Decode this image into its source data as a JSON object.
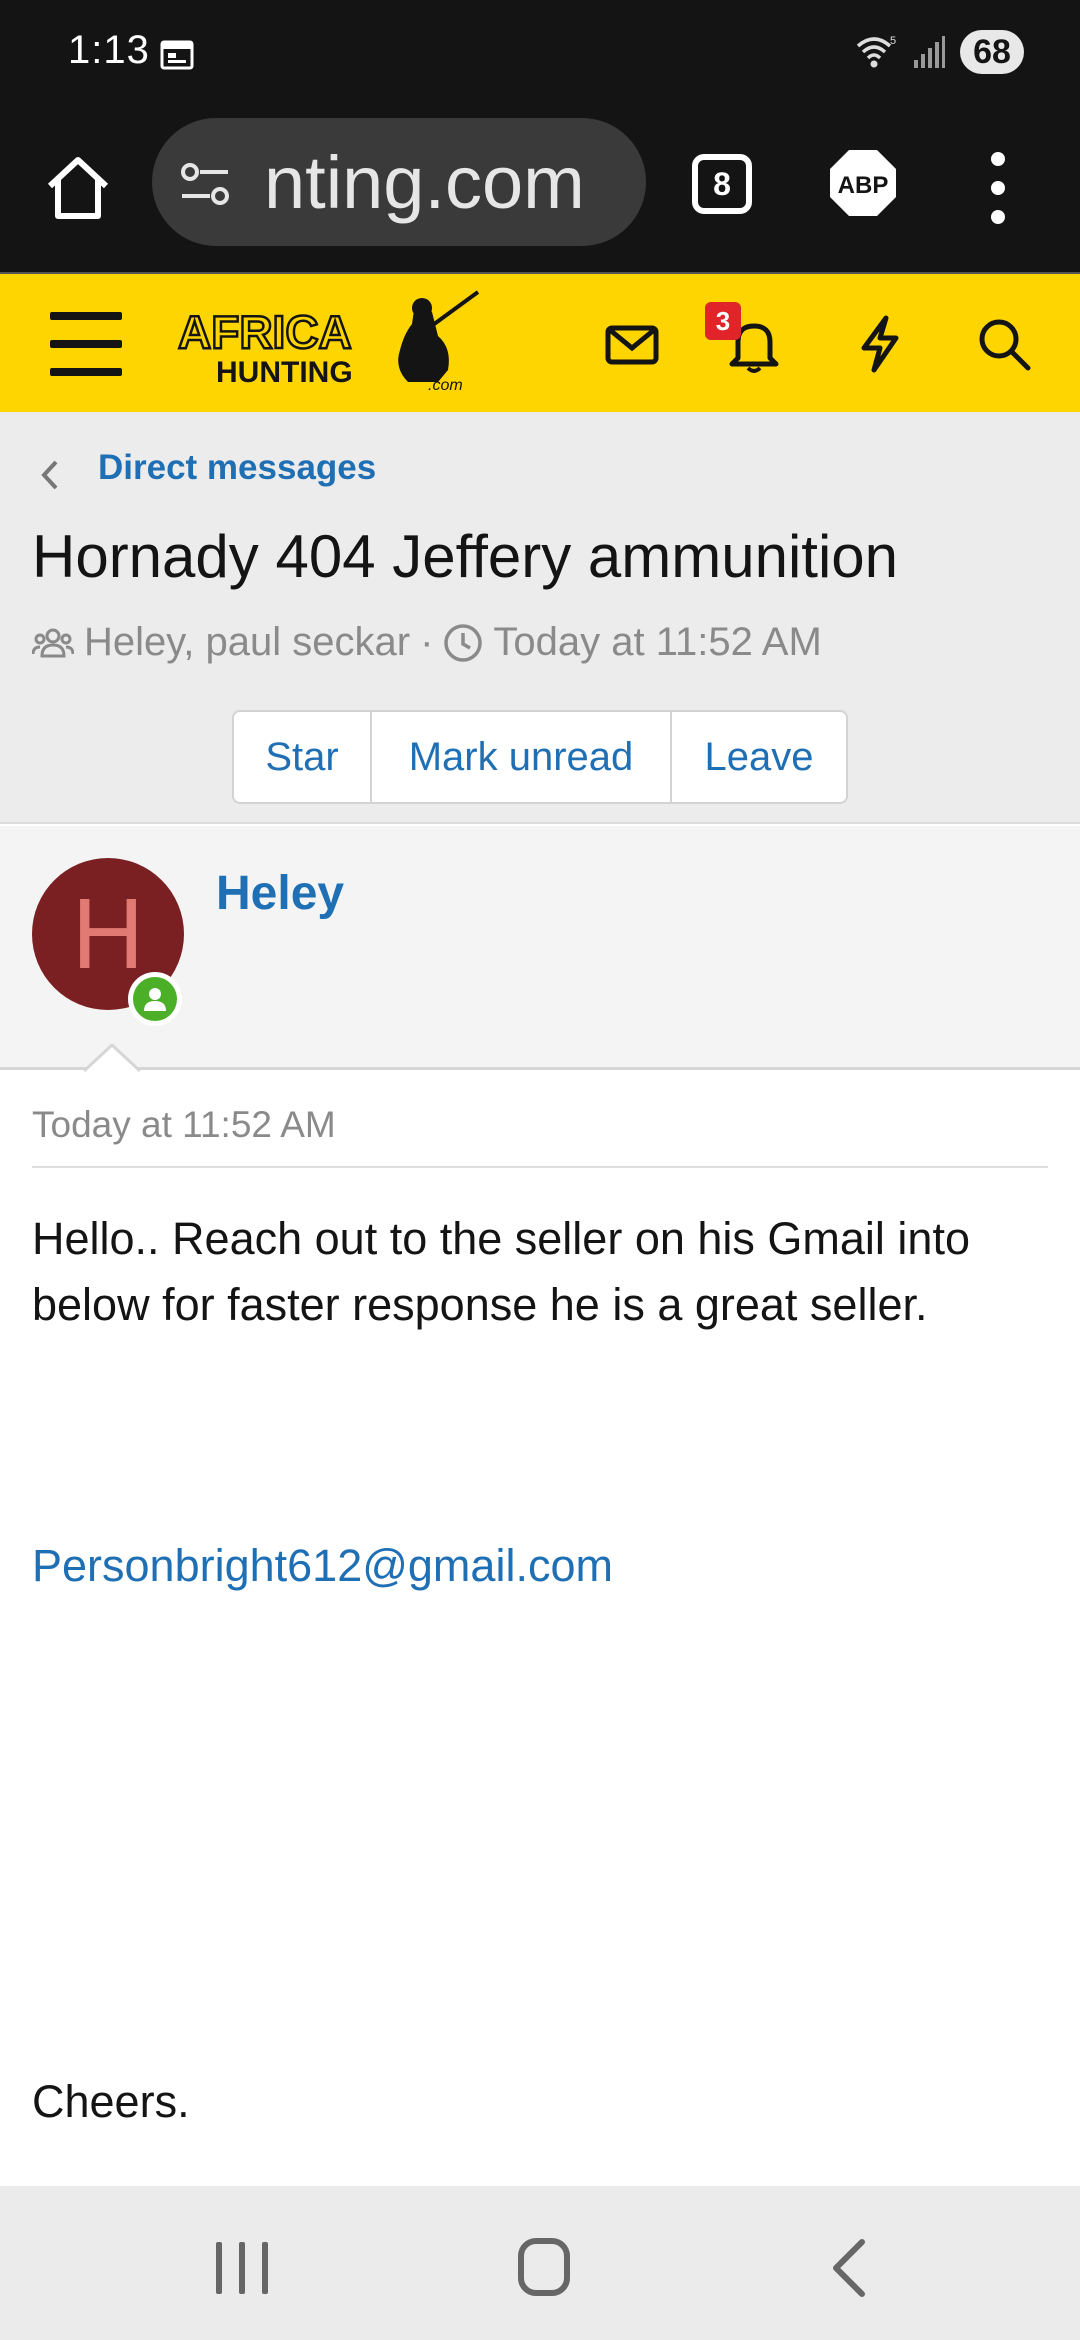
{
  "status_bar": {
    "time": "1:13",
    "battery": "68",
    "icons": [
      "calendar-icon",
      "wifi-icon",
      "signal-icon"
    ]
  },
  "browser": {
    "url": "nting.com",
    "tab_count": "8",
    "adblock_label": "ABP"
  },
  "site_header": {
    "logo_text_top": "AFRICA",
    "logo_text_bottom": "HUNTING",
    "logo_suffix": ".com",
    "notification_count": "3",
    "brand_color": "#ffd500"
  },
  "page": {
    "breadcrumb": "Direct messages",
    "title": "Hornady 404 Jeffery ammunition",
    "participants": "Heley, paul seckar",
    "separator": "·",
    "started": "Today at 11:52 AM",
    "actions": {
      "star": "Star",
      "mark_unread": "Mark unread",
      "leave": "Leave"
    }
  },
  "message": {
    "avatar_letter": "H",
    "username": "Heley",
    "date": "Today at 11:52 AM",
    "body": "Hello.. Reach out to the seller on his Gmail into below for faster response he is a great seller.",
    "email": "Personbright612@gmail.com",
    "closing": "Cheers."
  },
  "colors": {
    "link": "#1f6fb5",
    "avatar_bg": "#7a1f22",
    "online": "#4caf28",
    "badge": "#e0242a"
  }
}
